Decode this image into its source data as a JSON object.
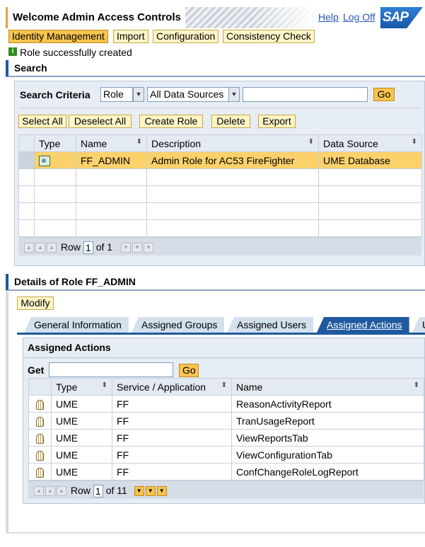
{
  "header": {
    "title": "Welcome Admin Access Controls",
    "help": "Help",
    "logoff": "Log Off",
    "logo": "SAP"
  },
  "nav_tabs": [
    "Identity Management",
    "Import",
    "Configuration",
    "Consistency Check"
  ],
  "message": {
    "icon": "info-icon",
    "text": "Role successfully created"
  },
  "search": {
    "section_title": "Search",
    "criteria_label": "Search Criteria",
    "object_type": "Role",
    "data_source": "All Data Sources",
    "query": "",
    "go": "Go",
    "toolbar": [
      "Select All",
      "Deselect All",
      "Create Role",
      "Delete",
      "Export"
    ],
    "columns": [
      "Type",
      "Name",
      "Description",
      "Data Source"
    ],
    "rows": [
      {
        "type_icon": "role-icon",
        "name": "FF_ADMIN",
        "description": "Admin Role for AC53 FireFighter",
        "data_source": "UME Database"
      }
    ],
    "pager": {
      "row_label": "Row",
      "row": "1",
      "of": "of 1"
    }
  },
  "details": {
    "section_title": "Details of Role FF_ADMIN",
    "modify": "Modify",
    "tabs": [
      "General Information",
      "Assigned Groups",
      "Assigned Users",
      "Assigned Actions",
      "U"
    ],
    "active_tab": "Assigned Actions",
    "panel_title": "Assigned Actions",
    "get_label": "Get",
    "get_value": "",
    "go": "Go",
    "columns": [
      "Type",
      "Service / Application",
      "Name"
    ],
    "rows": [
      {
        "type": "UME",
        "service": "FF",
        "name": "ReasonActivityReport"
      },
      {
        "type": "UME",
        "service": "FF",
        "name": "TranUsageReport"
      },
      {
        "type": "UME",
        "service": "FF",
        "name": "ViewReportsTab"
      },
      {
        "type": "UME",
        "service": "FF",
        "name": "ViewConfigurationTab"
      },
      {
        "type": "UME",
        "service": "FF",
        "name": "ConfChangeRoleLogReport"
      }
    ],
    "pager": {
      "row_label": "Row",
      "row": "1",
      "of": "of 11"
    }
  }
}
